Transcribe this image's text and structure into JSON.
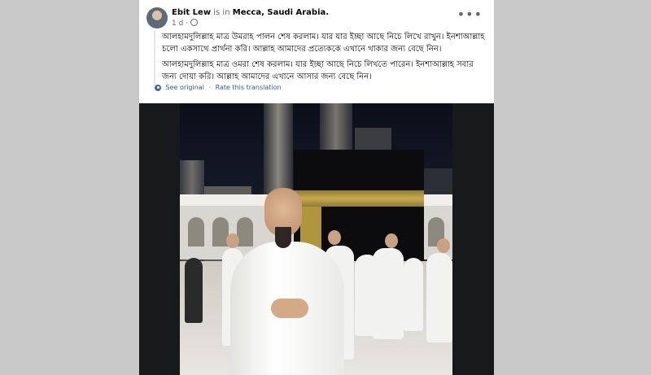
{
  "post": {
    "author": "Ebit Lew",
    "is_in_text": "is in",
    "location": "Mecca, Saudi Arabia.",
    "timestamp": "1 d",
    "more_icon": "•••",
    "translation": {
      "paragraph_1": "আলহামদুলিল্লাহ মাত্র উমরাহ পালন শেষ করলাম। যার যার ইচ্ছা আছে নিচে লিখে রাখুন। ইনশাআল্লাহ চলো একসাথে প্রার্থনা করি। আল্লাহ আমাদের প্রত্যেককে এখানে থাকার জন্য বেছে নিন।",
      "paragraph_2": "আলহামদুলিল্লাহ মাত্র ওমরা শেষ করলাম। যার ইচ্ছা আছে নিচে লিখতে পারেন। ইনশাআল্লাহ সবার জন্য দোয়া করি। আল্লাহ আমাদের এখানে আসার জন্য বেছে নিন।",
      "see_original": "See original",
      "separator": "·",
      "rate": "Rate this translation"
    }
  },
  "icons": {
    "avatar": "avatar",
    "globe": "globe-icon",
    "more": "more-options-icon",
    "translate": "gear-icon"
  },
  "colors": {
    "page_bg": "#c9c9c9",
    "card_bg": "#ffffff",
    "link": "#385898",
    "muted": "#65676b"
  }
}
